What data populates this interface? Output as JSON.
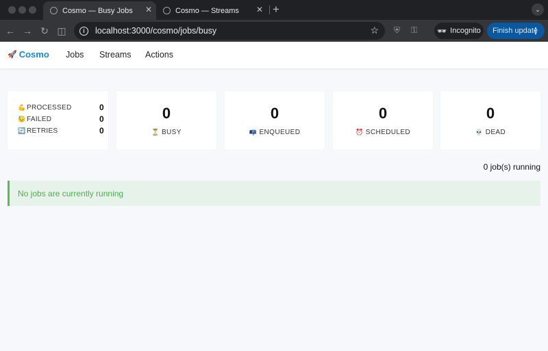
{
  "browser": {
    "tabs": [
      {
        "title": "Cosmo — Busy Jobs",
        "active": true
      },
      {
        "title": "Cosmo — Streams",
        "active": false
      }
    ],
    "url": "localhost:3000/cosmo/jobs/busy",
    "incognito_label": "Incognito",
    "finish_update_label": "Finish update"
  },
  "nav": {
    "brand": "Cosmo",
    "brand_icon": "🚀",
    "links": [
      "Jobs",
      "Streams",
      "Actions"
    ]
  },
  "summary": [
    {
      "icon": "💪",
      "label": "PROCESSED",
      "value": "0"
    },
    {
      "icon": "😓",
      "label": "FAILED",
      "value": "0"
    },
    {
      "icon": "🔄",
      "label": "RETRIES",
      "value": "0"
    }
  ],
  "stats": [
    {
      "icon": "⏳",
      "label": "BUSY",
      "value": "0"
    },
    {
      "icon": "📭",
      "label": "ENQUEUED",
      "value": "0"
    },
    {
      "icon": "⏰",
      "label": "SCHEDULED",
      "value": "0"
    },
    {
      "icon": "💀",
      "label": "DEAD",
      "value": "0"
    }
  ],
  "running_text": "0 job(s) running",
  "alert_text": "No jobs are currently running",
  "colors": {
    "brand": "#1a86d0",
    "alert_bg": "#e7f3ea",
    "alert_border": "#5cb85c",
    "alert_text": "#4cae4c"
  }
}
